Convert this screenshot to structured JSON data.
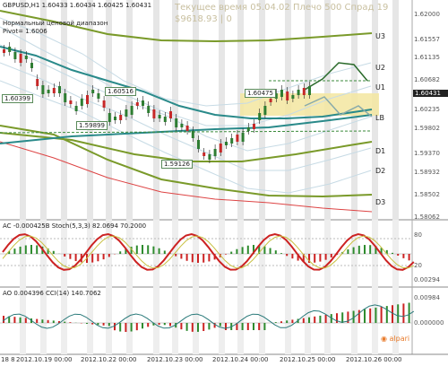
{
  "header": {
    "symbol_info": "GBPUSD,H1  1.60433  1.60434  1.60425  1.60431",
    "range_title": "Нормальный ценовой диапазон",
    "pivot": "Pivot= 1.6006",
    "server_time": "Текущее время 05.04.02 Плечо 500 Спрад 19",
    "balance": "$9618.93   | 0"
  },
  "levels": {
    "U3": "U3",
    "U2": "U2",
    "U1": "U1",
    "LB": "LB",
    "D1": "D1",
    "D2": "D2",
    "D3": "D3"
  },
  "annotations": {
    "p1": "1.60399",
    "p2": "1.60516",
    "p3": "1.59899",
    "p4": "1.59126",
    "p5": "1.60475"
  },
  "price_axis": [
    "1.62000",
    "1.61557",
    "1.61135",
    "1.60682",
    "1.60431",
    "1.60235",
    "1.59802",
    "1.59370",
    "1.58932",
    "1.58502",
    "1.58062"
  ],
  "current_price": "1.60431",
  "indicators": {
    "ac_stoch": "AC -0.000425B  Stoch(5,3,3) 82.0694 70.2000",
    "ao_cci": "AO 0.004396  CCI(14) 140.7062",
    "ac_axis": [
      "80",
      "20",
      "0.00294"
    ],
    "ao_axis": [
      "0.00984",
      "0.000000"
    ]
  },
  "dates": [
    "18 8",
    "2012.10.19 00:00",
    "2012.10.22 00:00",
    "2012.10.23 00:00",
    "2012.10.24 00:00",
    "2012.10.25 00:00",
    "2012.10.26 00:00"
  ],
  "logo": "alpari",
  "colors": {
    "bull": "#2e7d32",
    "bear": "#c62828",
    "teal_ma": "#2a8a8a",
    "band": "#7a9a2a",
    "red_ma": "#d44",
    "ac_red": "#cc2222",
    "ac_green": "#2e8b2e",
    "yellow_zone": "#f3e6a0"
  }
}
